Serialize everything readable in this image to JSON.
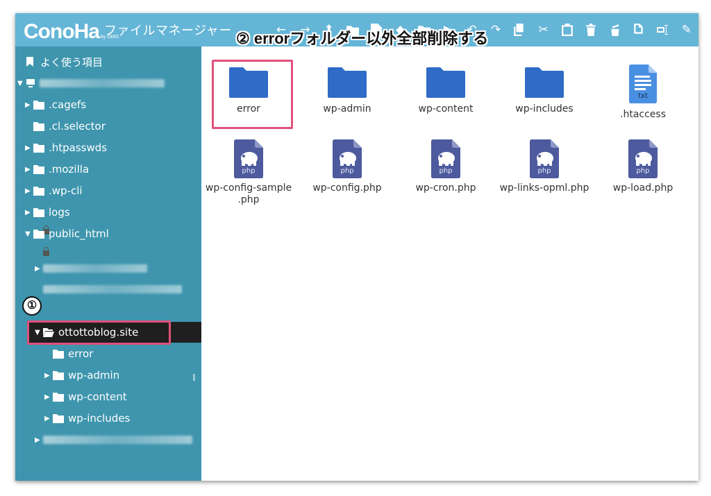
{
  "header": {
    "logo": "ConoHa",
    "logo_sub": "by GMO",
    "title": "ファイルマネージャー"
  },
  "toolbar": {
    "icons": [
      "back-arrow-icon",
      "forward-arrow-icon",
      "up-icon",
      "new-folder-icon",
      "new-file-icon",
      "upload-icon",
      "folder-icon",
      "play-icon",
      "undo-icon",
      "redo-icon",
      "copy-icon",
      "cut-icon",
      "paste-icon",
      "trash-icon",
      "empty-icon",
      "duplicate-icon",
      "rename-icon",
      "edit-icon"
    ]
  },
  "annotations": {
    "step1": "①",
    "step2": "② errorフォルダー以外全部削除する"
  },
  "sidebar": {
    "favorites": "よく使う項目",
    "items": [
      {
        "label": ".cagefs"
      },
      {
        "label": ".cl.selector"
      },
      {
        "label": ".htpasswds"
      },
      {
        "label": ".mozilla"
      },
      {
        "label": ".wp-cli"
      },
      {
        "label": "logs"
      },
      {
        "label": "public_html"
      },
      {
        "label": "ottottoblog.site"
      },
      {
        "label": "error"
      },
      {
        "label": "wp-admin"
      },
      {
        "label": "wp-content"
      },
      {
        "label": "wp-includes"
      }
    ]
  },
  "files": [
    {
      "name": "error",
      "type": "folder"
    },
    {
      "name": "wp-admin",
      "type": "folder"
    },
    {
      "name": "wp-content",
      "type": "folder"
    },
    {
      "name": "wp-includes",
      "type": "folder"
    },
    {
      "name": ".htaccess",
      "type": "txt",
      "badge": "txt"
    },
    {
      "name": "wp-config-sample.php",
      "line1": "wp-config-sample",
      "line2": ".php",
      "type": "php",
      "badge": "php"
    },
    {
      "name": "wp-config.php",
      "type": "php",
      "badge": "php"
    },
    {
      "name": "wp-cron.php",
      "type": "php",
      "badge": "php"
    },
    {
      "name": "wp-links-opml.php",
      "type": "php",
      "badge": "php"
    },
    {
      "name": "wp-load.php",
      "type": "php",
      "badge": "php"
    }
  ],
  "colors": {
    "header": "#64b5d6",
    "sidebar": "#3e95ad",
    "folder": "#2f6bc7",
    "php": "#4d5a9e",
    "highlight": "#e0507a"
  }
}
